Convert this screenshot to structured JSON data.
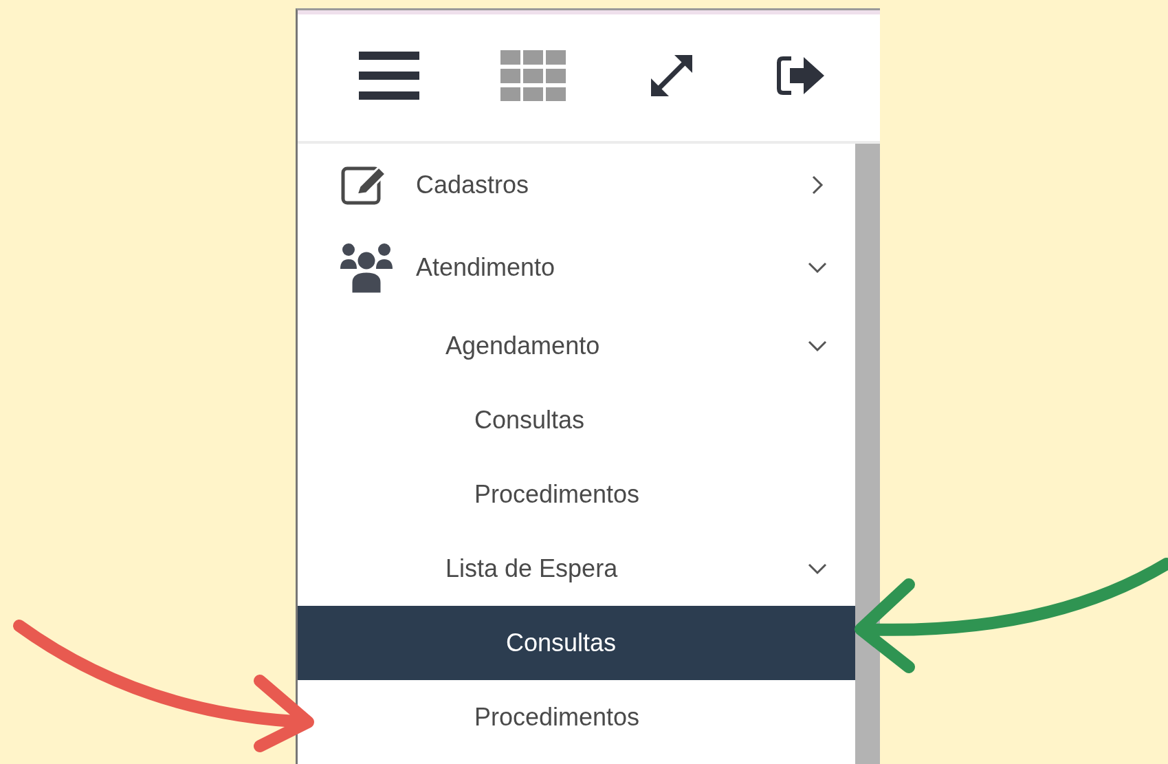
{
  "toolbar": {
    "buttons": [
      {
        "kind": "menu"
      },
      {
        "kind": "apps"
      },
      {
        "kind": "expand"
      },
      {
        "kind": "logout"
      }
    ]
  },
  "menu": [
    {
      "label": "Cadastros",
      "kind": "edit",
      "expanded": false,
      "selected": false
    },
    {
      "label": "Atendimento",
      "kind": "users",
      "expanded": true,
      "selected": false,
      "children": [
        {
          "label": "Agendamento",
          "expanded": true,
          "selected": false,
          "children": [
            {
              "label": "Consultas",
              "selected": false
            },
            {
              "label": "Procedimentos",
              "selected": false
            }
          ]
        },
        {
          "label": "Lista de Espera",
          "expanded": true,
          "selected": false,
          "children": [
            {
              "label": "Consultas",
              "selected": true
            },
            {
              "label": "Procedimentos",
              "selected": false
            }
          ]
        }
      ]
    }
  ]
}
